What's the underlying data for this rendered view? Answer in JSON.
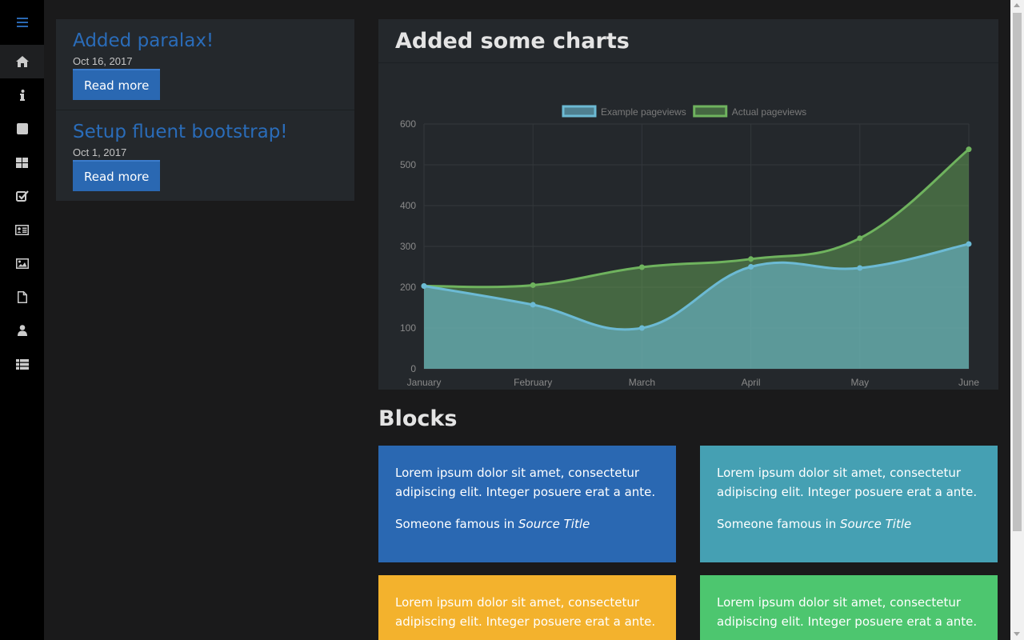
{
  "sidebar": {
    "items": [
      {
        "icon": "menu-icon",
        "active": false
      },
      {
        "icon": "home-icon",
        "active": true
      },
      {
        "icon": "info-icon",
        "active": false
      },
      {
        "icon": "square-icon",
        "active": false
      },
      {
        "icon": "grid-icon",
        "active": false
      },
      {
        "icon": "check-square-icon",
        "active": false
      },
      {
        "icon": "id-card-icon",
        "active": false
      },
      {
        "icon": "image-icon",
        "active": false
      },
      {
        "icon": "file-icon",
        "active": false
      },
      {
        "icon": "user-icon",
        "active": false
      },
      {
        "icon": "table-icon",
        "active": false
      }
    ],
    "accent": "#2a68b2"
  },
  "posts": [
    {
      "title": "Added paralax!",
      "date": "Oct 16, 2017",
      "button": "Read more"
    },
    {
      "title": "Setup fluent bootstrap!",
      "date": "Oct 1, 2017",
      "button": "Read more"
    }
  ],
  "chart_card": {
    "title": "Added some charts"
  },
  "chart_data": {
    "type": "area",
    "categories": [
      "January",
      "February",
      "March",
      "April",
      "May",
      "June"
    ],
    "series": [
      {
        "name": "Example pageviews",
        "values": [
          203,
          157,
          100,
          250,
          247,
          306
        ],
        "color": "#6cbad4"
      },
      {
        "name": "Actual pageviews",
        "values": [
          203,
          205,
          249,
          269,
          320,
          538
        ],
        "color": "#6fb35e"
      }
    ],
    "yticks": [
      0,
      100,
      200,
      300,
      400,
      500,
      600
    ],
    "ylim": [
      0,
      600
    ],
    "legend": "top-center",
    "grid": true
  },
  "blocks": {
    "title": "Blocks",
    "items": [
      {
        "text": "Lorem ipsum dolor sit amet, consectetur adipiscing elit. Integer posuere erat a ante.",
        "source_prefix": "Someone famous in ",
        "source_title": "Source Title",
        "color": "#2a68b2"
      },
      {
        "text": "Lorem ipsum dolor sit amet, consectetur adipiscing elit. Integer posuere erat a ante.",
        "source_prefix": "Someone famous in ",
        "source_title": "Source Title",
        "color": "#45a0b3"
      },
      {
        "text": "Lorem ipsum dolor sit amet, consectetur adipiscing elit. Integer posuere erat a ante.",
        "color": "#f3b22d"
      },
      {
        "text": "Lorem ipsum dolor sit amet, consectetur adipiscing elit. Integer posuere erat a ante.",
        "color": "#4dc66f"
      }
    ]
  }
}
